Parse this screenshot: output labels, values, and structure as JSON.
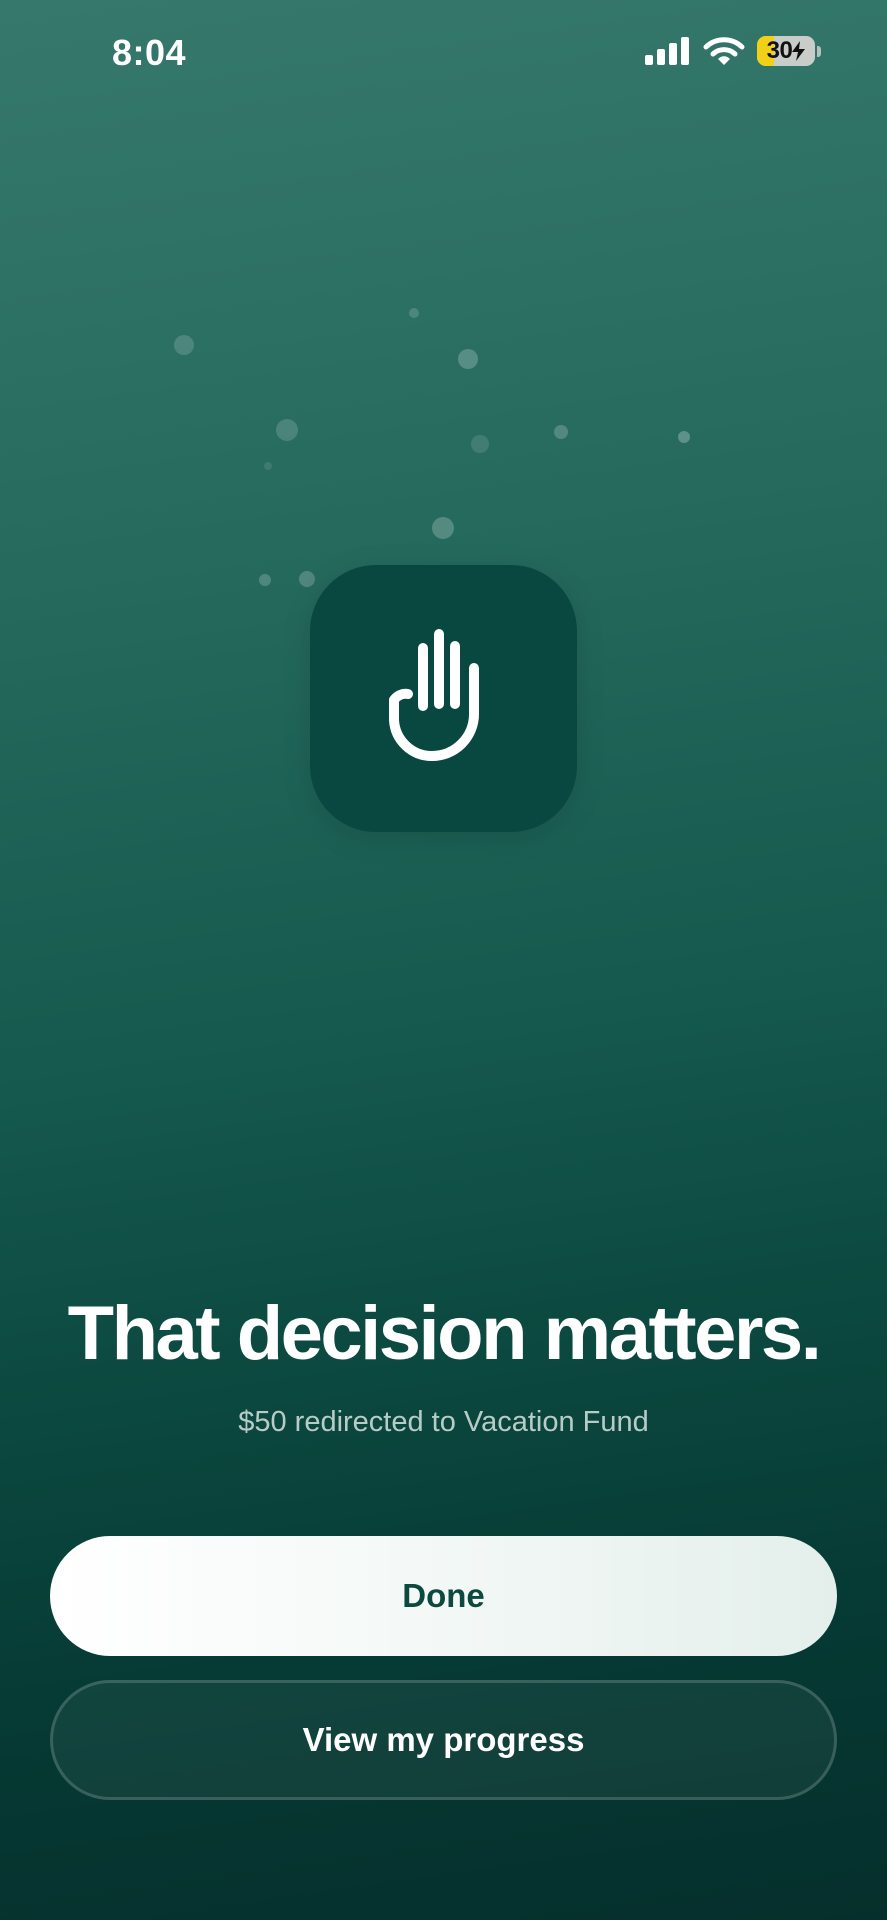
{
  "status_bar": {
    "time": "8:04",
    "icons": [
      "cellular-signal-icon",
      "wifi-icon",
      "battery-charging-icon"
    ],
    "battery_percent": "30",
    "battery_level": 0.3,
    "battery_color": "#f3d018"
  },
  "hero": {
    "icon": "raised-hand-icon",
    "tile_color": "#084840"
  },
  "content": {
    "headline": "That decision matters.",
    "subtitle": "$50 redirected to Vacation Fund"
  },
  "actions": {
    "done_label": "Done",
    "progress_label": "View my progress"
  },
  "colors": {
    "background_top": "#36786c",
    "background_bottom": "#052f2c",
    "primary_button_text": "#0c4a40",
    "subtitle_text": "#b7ccc6"
  }
}
